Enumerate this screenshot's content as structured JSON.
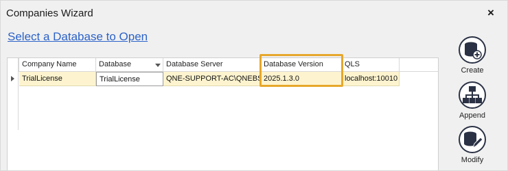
{
  "window": {
    "title": "Companies Wizard",
    "close_glyph": "×"
  },
  "main": {
    "heading": "Select a Database to Open"
  },
  "grid": {
    "columns": [
      "Company Name",
      "Database",
      "Database Server",
      "Database Version",
      "QLS"
    ],
    "rows": [
      [
        "TrialLicense",
        "TrialLicense",
        "QNE-SUPPORT-AC\\QNEBSS",
        "2025.1.3.0",
        "localhost:10010"
      ]
    ],
    "active_cell_column": 1,
    "highlighted_column": "Database Version",
    "highlight_color": "#e6a72b",
    "row_color": "#fdf4cf"
  },
  "sidebar": {
    "buttons": [
      {
        "label": "Create",
        "icon": "database-create-icon"
      },
      {
        "label": "Append",
        "icon": "network-append-icon"
      },
      {
        "label": "Modify",
        "icon": "edit-modify-icon"
      }
    ]
  },
  "colors": {
    "link": "#2b62c8",
    "icon": "#2b3245"
  }
}
